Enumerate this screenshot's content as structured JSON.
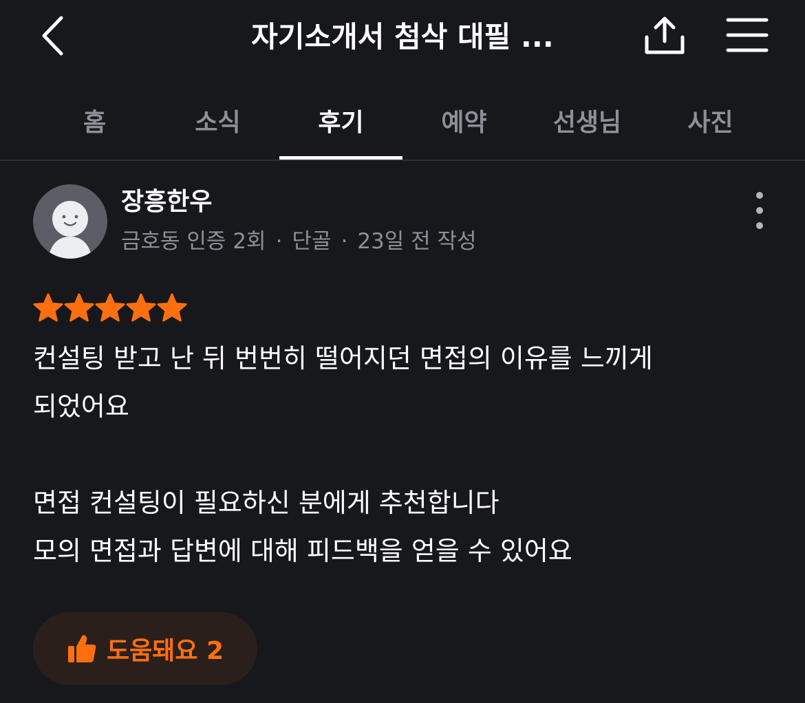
{
  "header": {
    "title": "자기소개서 첨삭 대필 ..."
  },
  "tabs": [
    {
      "label": "홈",
      "active": false
    },
    {
      "label": "소식",
      "active": false
    },
    {
      "label": "후기",
      "active": true
    },
    {
      "label": "예약",
      "active": false
    },
    {
      "label": "선생님",
      "active": false
    },
    {
      "label": "사진",
      "active": false
    }
  ],
  "review": {
    "author_name": "장흥한우",
    "verification": "금호동 인증 2회",
    "regular": "단골",
    "posted": "23일 전 작성",
    "rating": 5,
    "text_lines": [
      "컨설팅 받고 난 뒤 번번히 떨어지던 면접의 이유를 느끼게",
      "되었어요",
      "면접 컨설팅이 필요하신 분에게 추천합니다",
      "모의 면접과 답변에 대해 피드백을 얻을 수 있어요"
    ],
    "helpful_label": "도움돼요 2"
  },
  "colors": {
    "background": "#17181c",
    "accent": "#ff6f0f",
    "muted_text": "#8e9098",
    "avatar": "#5b5e66",
    "helpful_bg": "#2b1f1c"
  }
}
